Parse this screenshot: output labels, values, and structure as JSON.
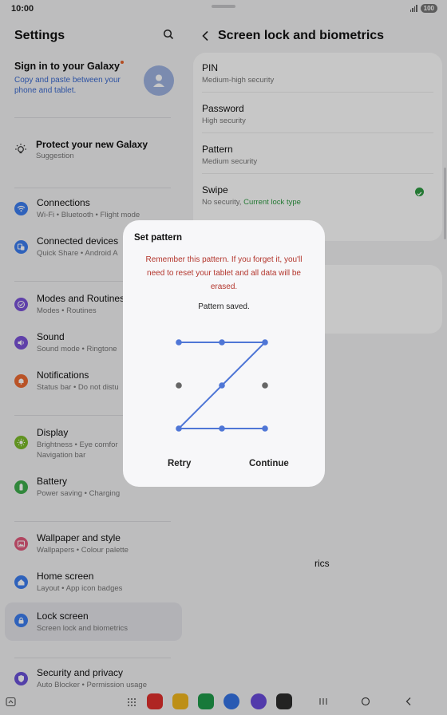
{
  "status_bar": {
    "time": "10:00",
    "battery": "100"
  },
  "settings": {
    "title": "Settings",
    "galaxy": {
      "title": "Sign in to your Galaxy",
      "subtitle": "Copy and paste between your phone and tablet."
    },
    "suggestion": {
      "title": "Protect your new Galaxy",
      "subtitle": "Suggestion"
    },
    "items": [
      {
        "title": "Connections",
        "subtitle": "Wi-Fi  •  Bluetooth  •  Flight mode",
        "color": "#3d7ef0",
        "icon": "wifi-icon"
      },
      {
        "title": "Connected devices",
        "subtitle": "Quick Share  •  Android A",
        "color": "#3d7ef0",
        "icon": "devices-icon"
      },
      {
        "title": "Modes and Routines",
        "subtitle": "Modes  •  Routines",
        "color": "#7a52d9",
        "icon": "check-circle-icon"
      },
      {
        "title": "Sound",
        "subtitle": "Sound mode  •  Ringtone",
        "color": "#7a52d9",
        "icon": "volume-icon"
      },
      {
        "title": "Notifications",
        "subtitle": "Status bar  •  Do not distu",
        "color": "#ee6b33",
        "icon": "bell-icon"
      },
      {
        "title": "Display",
        "subtitle": "Brightness  •  Eye comfor",
        "subtitle2": "Navigation bar",
        "color": "#7cbc2a",
        "icon": "sun-icon"
      },
      {
        "title": "Battery",
        "subtitle": "Power saving  •  Charging",
        "color": "#3fae4d",
        "icon": "battery-icon"
      },
      {
        "title": "Wallpaper and style",
        "subtitle": "Wallpapers  •  Colour palette",
        "color": "#e25a7d",
        "icon": "wallpaper-icon"
      },
      {
        "title": "Home screen",
        "subtitle": "Layout  •  App icon badges",
        "color": "#3d7ef0",
        "icon": "home-icon"
      },
      {
        "title": "Lock screen",
        "subtitle": "Screen lock and biometrics",
        "color": "#3d7ef0",
        "icon": "lock-icon"
      },
      {
        "title": "Security and privacy",
        "subtitle": "Auto Blocker  •  Permission usage",
        "color": "#6b52d9",
        "icon": "shield-icon"
      }
    ]
  },
  "screen_lock": {
    "title": "Screen lock and biometrics",
    "options": [
      {
        "title": "PIN",
        "subtitle": "Medium-high security"
      },
      {
        "title": "Password",
        "subtitle": "High security"
      },
      {
        "title": "Pattern",
        "subtitle": "Medium security"
      },
      {
        "title": "Swipe",
        "subtitle": "No security, ",
        "current": "Current lock type"
      }
    ],
    "partial_text": "rics"
  },
  "dialog": {
    "title": "Set pattern",
    "warning": "Remember this pattern. If you forget it, you'll need to reset your tablet and all data will be erased.",
    "status": "Pattern saved.",
    "retry": "Retry",
    "continue": "Continue",
    "pattern_sequence": [
      1,
      2,
      3,
      5,
      7,
      8,
      9
    ],
    "accent": "#4f76d6"
  },
  "dock_apps": [
    {
      "name": "app-red",
      "color": "#e0302d"
    },
    {
      "name": "app-files",
      "color": "#f2b81e"
    },
    {
      "name": "app-phone",
      "color": "#1f9c4b"
    },
    {
      "name": "app-messages",
      "color": "#3574e6"
    },
    {
      "name": "app-internet",
      "color": "#6a4bdb"
    },
    {
      "name": "app-camera",
      "color": "#2d2d2d"
    }
  ]
}
